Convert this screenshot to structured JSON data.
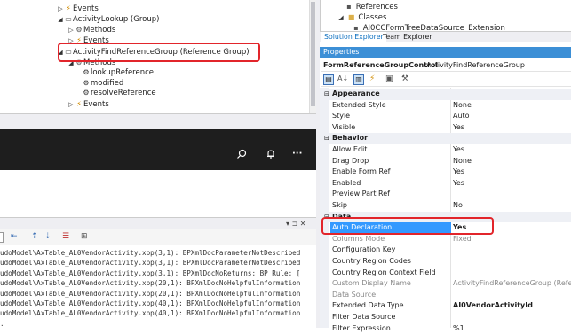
{
  "tree": {
    "items": [
      {
        "label": "Events",
        "icon": "bolt-icon",
        "expand": "▷"
      },
      {
        "label": "ActivityLookup (Group)",
        "icon": "group-icon",
        "expand": "◢"
      },
      {
        "label": "Methods",
        "icon": "methods-icon",
        "expand": "▷"
      },
      {
        "label": "Events",
        "icon": "bolt-icon",
        "expand": "▷"
      },
      {
        "label": "ActivityFindReferenceGroup (Reference Group)",
        "icon": "group-icon",
        "expand": "◢"
      },
      {
        "label": "Methods",
        "icon": "methods-icon",
        "expand": "◢"
      },
      {
        "label": "lookupReference",
        "icon": "method-icon",
        "expand": ""
      },
      {
        "label": "modified",
        "icon": "method-icon",
        "expand": ""
      },
      {
        "label": "resolveReference",
        "icon": "method-icon",
        "expand": ""
      },
      {
        "label": "Events",
        "icon": "bolt-icon",
        "expand": "▷"
      }
    ]
  },
  "solution": {
    "items": [
      {
        "label": "References"
      },
      {
        "label": "Classes"
      },
      {
        "label": "AI0CCFormTreeDataSource_Extension"
      }
    ],
    "tabs": [
      "Solution Explorer",
      "Team Explorer"
    ]
  },
  "preview_toolbar": {
    "search_icon": "search-icon",
    "bell_icon": "bell-icon",
    "more_label": "···"
  },
  "output": {
    "lines": [
      "udoModel\\AxTable_AL0VendorActivity.xpp(3,1):   BPXmlDocParameterNotDescribed",
      "udoModel\\AxTable_AL0VendorActivity.xpp(3,1):   BPXmlDocParameterNotDescribed",
      "udoModel\\AxTable_AL0VendorActivity.xpp(3,1):   BPXmlDocNoReturns: BP Rule: [",
      "udoModel\\AxTable_AL0VendorActivity.xpp(20,1):  BPXmlDocNoHelpfulInformation",
      "udoModel\\AxTable_AL0VendorActivity.xpp(20,1):  BPXmlDocNoHelpfulInformation",
      "udoModel\\AxTable_AL0VendorActivity.xpp(40,1):  BPXmlDocNoHelpfulInformation",
      "udoModel\\AxTable_AL0VendorActivity.xpp(40,1):  BPXmlDocNoHelpfulInformation",
      "."
    ],
    "pin_label": "▾ ⊐ ✕"
  },
  "properties": {
    "title": "Properties",
    "object_type": "FormReferenceGroupControl",
    "object_name": "ActivityFindReferenceGroup",
    "categories": [
      {
        "name": "Appearance",
        "rows": [
          {
            "name": "Extended Style",
            "value": "None",
            "gray": false
          },
          {
            "name": "Style",
            "value": "Auto",
            "gray": false
          },
          {
            "name": "Visible",
            "value": "Yes",
            "gray": false
          }
        ]
      },
      {
        "name": "Behavior",
        "rows": [
          {
            "name": "Allow Edit",
            "value": "Yes",
            "gray": false
          },
          {
            "name": "Drag Drop",
            "value": "None",
            "gray": false
          },
          {
            "name": "Enable Form Ref",
            "value": "Yes",
            "gray": false
          },
          {
            "name": "Enabled",
            "value": "Yes",
            "gray": false
          },
          {
            "name": "Preview Part Ref",
            "value": "",
            "gray": false
          },
          {
            "name": "Skip",
            "value": "No",
            "gray": false
          }
        ]
      },
      {
        "name": "Data",
        "rows": [
          {
            "name": "Auto Declaration",
            "value": "Yes",
            "gray": false,
            "selected": true
          },
          {
            "name": "Columns Mode",
            "value": "Fixed",
            "gray": true
          },
          {
            "name": "Configuration Key",
            "value": "",
            "gray": false
          },
          {
            "name": "Country Region Codes",
            "value": "",
            "gray": false
          },
          {
            "name": "Country Region Context Field",
            "value": "",
            "gray": false
          },
          {
            "name": "Custom Display Name",
            "value": "ActivityFindReferenceGroup (Refer",
            "gray": true
          },
          {
            "name": "Data Source",
            "value": "",
            "gray": true
          },
          {
            "name": "Extended Data Type",
            "value": "AI0VendorActivityId",
            "gray": false,
            "bold_value": true
          },
          {
            "name": "Filter Data Source",
            "value": "",
            "gray": false
          },
          {
            "name": "Filter Expression",
            "value": "%1",
            "gray": false
          }
        ]
      }
    ]
  },
  "colors": {
    "accent": "#3399ff",
    "highlight_box": "#e2252b",
    "titlebar": "#1e1e1e",
    "panel_header": "#3c8fd6"
  }
}
